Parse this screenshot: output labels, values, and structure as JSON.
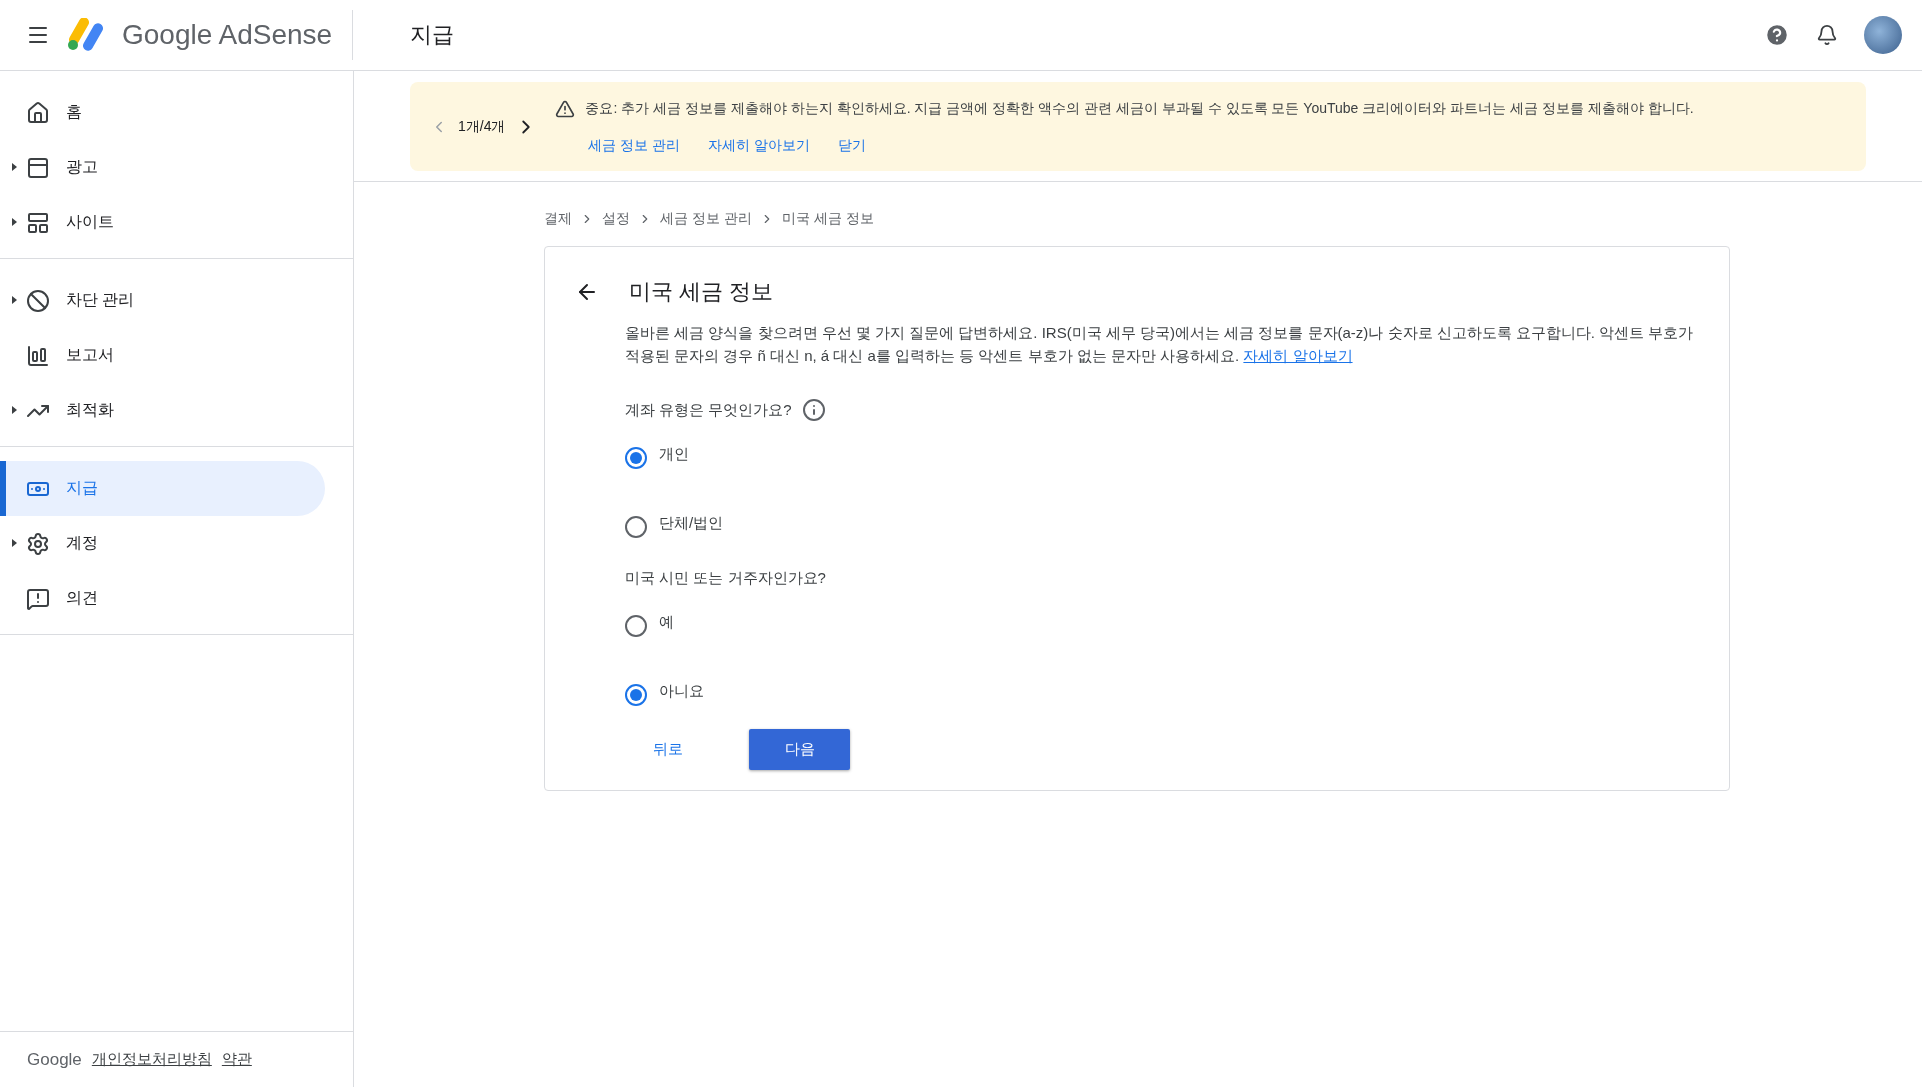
{
  "header": {
    "brand": "Google AdSense",
    "page_title": "지급"
  },
  "sidebar": {
    "groups": [
      {
        "items": [
          {
            "label": "홈",
            "expandable": false,
            "selected": false
          },
          {
            "label": "광고",
            "expandable": true,
            "selected": false
          },
          {
            "label": "사이트",
            "expandable": true,
            "selected": false
          }
        ]
      },
      {
        "items": [
          {
            "label": "차단 관리",
            "expandable": true,
            "selected": false
          },
          {
            "label": "보고서",
            "expandable": false,
            "selected": false
          },
          {
            "label": "최적화",
            "expandable": true,
            "selected": false
          }
        ]
      },
      {
        "items": [
          {
            "label": "지급",
            "expandable": false,
            "selected": true
          },
          {
            "label": "계정",
            "expandable": true,
            "selected": false
          },
          {
            "label": "의견",
            "expandable": false,
            "selected": false
          }
        ]
      }
    ],
    "footer": {
      "brand": "Google",
      "links": [
        "개인정보처리방침",
        "약관"
      ]
    }
  },
  "banner": {
    "pager": "1개/4개",
    "message": "중요: 추가 세금 정보를 제출해야 하는지 확인하세요. 지급 금액에 정확한 액수의 관련 세금이 부과될 수 있도록 모든 YouTube 크리에이터와 파트너는 세금 정보를 제출해야 합니다.",
    "actions": [
      "세금 정보 관리",
      "자세히 알아보기",
      "닫기"
    ]
  },
  "breadcrumb": [
    "결제",
    "설정",
    "세금 정보 관리",
    "미국 세금 정보"
  ],
  "card": {
    "title": "미국 세금 정보",
    "intro": "올바른 세금 양식을 찾으려면 우선 몇 가지 질문에 답변하세요. IRS(미국 세무 당국)에서는 세금 정보를 문자(a-z)나 숫자로 신고하도록 요구합니다. 악센트 부호가 적용된 문자의 경우 ñ 대신 n, á 대신 a를 입력하는 등 악센트 부호가 없는 문자만 사용하세요.",
    "intro_link": "자세히 알아보기",
    "questions": [
      {
        "label": "계좌 유형은 무엇인가요?",
        "info": true,
        "options": [
          {
            "label": "개인",
            "selected": true
          },
          {
            "label": "단체/법인",
            "selected": false
          }
        ]
      },
      {
        "label": "미국 시민 또는 거주자인가요?",
        "info": false,
        "options": [
          {
            "label": "예",
            "selected": false
          },
          {
            "label": "아니요",
            "selected": true
          }
        ]
      }
    ],
    "back_button": "뒤로",
    "next_button": "다음"
  }
}
